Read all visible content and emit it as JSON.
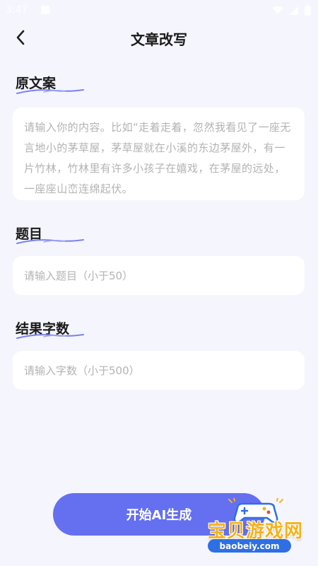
{
  "status_bar": {
    "time": "3:47",
    "icons": [
      "notification-icon",
      "wifi-icon",
      "signal-icon",
      "battery-icon"
    ]
  },
  "header": {
    "title": "文章改写",
    "back_icon": "chevron-left-icon"
  },
  "sections": {
    "original": {
      "label": "原文案",
      "placeholder": "请输入你的内容。比如“走着走着，忽然我看见了一座无言地小的茅草屋，茅草屋就在小溪的东边茅屋外，有一片竹林，竹林里有许多小孩子在嬉戏，在茅屋的远处，一座座山峦连绵起伏。"
    },
    "title": {
      "label": "题目",
      "placeholder": "请输入题目（小于50）"
    },
    "word_count": {
      "label": "结果字数",
      "placeholder": "请输入字数（小于500）"
    }
  },
  "cta": {
    "label": "开始AI生成"
  },
  "watermark": {
    "logo_text": "宝贝游戏网",
    "url": "baobeiy.com"
  },
  "colors": {
    "background": "#f5f5fd",
    "accent": "#6470f0",
    "underline": "#7b82ee",
    "placeholder": "#b3b3b3",
    "watermark_yellow": "#f6b21a",
    "watermark_blue": "#2f6fe4"
  }
}
